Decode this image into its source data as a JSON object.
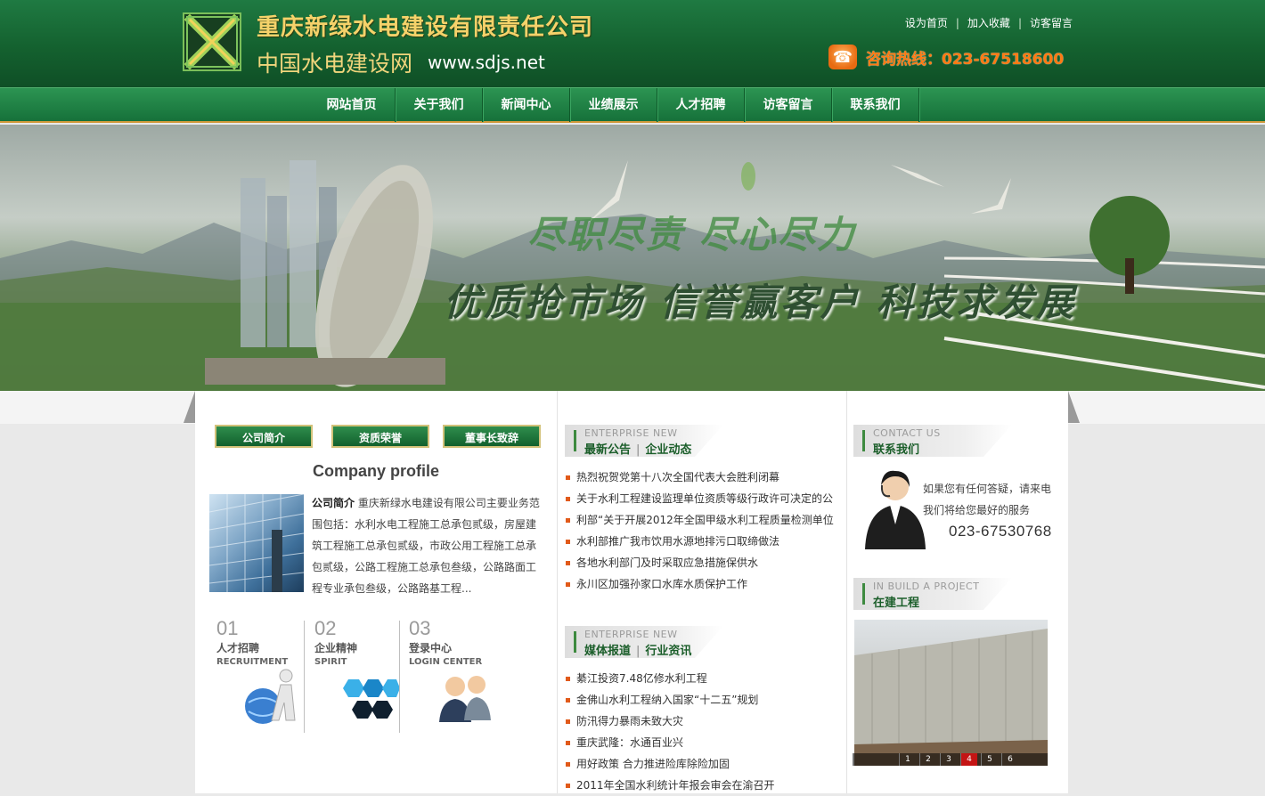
{
  "header": {
    "company_name": "重庆新绿水电建设有限责任公司",
    "site_name": "中国水电建设网",
    "site_url": "www.sdjs.net",
    "top_links": [
      "设为首页",
      "加入收藏",
      "访客留言"
    ],
    "hotline": "咨询热线：023-67518600"
  },
  "nav": {
    "items": [
      "网站首页",
      "关于我们",
      "新闻中心",
      "业绩展示",
      "人才招聘",
      "访客留言",
      "联系我们"
    ]
  },
  "banner": {
    "slogan_top": "尽职尽责 尽心尽力",
    "slogan_main": "优质抢市场 信誉赢客户 科技求发展"
  },
  "about": {
    "tabs": [
      "公司简介",
      "资质荣誉",
      "董事长致辞"
    ],
    "heading": "Company profile",
    "intro_label": "公司简介",
    "intro_text": "重庆新绿水电建设有限公司主要业务范围包括：水利水电工程施工总承包贰级，房屋建筑工程施工总承包贰级，市政公用工程施工总承包贰级，公路工程施工总承包叁级，公路路面工程专业承包叁级，公路路基工程..."
  },
  "quick_links": [
    {
      "num": "01",
      "title": "人才招聘",
      "en": "RECRUITMENT",
      "icon": "globe-person-icon"
    },
    {
      "num": "02",
      "title": "企业精神",
      "en": "SPIRIT",
      "icon": "hexagon-cluster-icon"
    },
    {
      "num": "03",
      "title": "登录中心",
      "en": "LOGIN CENTER",
      "icon": "users-icon"
    }
  ],
  "news_section": {
    "en": "ENTERPRISE NEW",
    "tab1": "最新公告",
    "tab2": "企业动态",
    "items": [
      "热烈祝贺党第十八次全国代表大会胜利闭幕",
      "关于水利工程建设监理单位资质等级行政许可决定的公",
      "利部“关于开展2012年全国甲级水利工程质量检测单位",
      "水利部推广我市饮用水源地排污口取缔做法",
      "各地水利部门及时采取应急措施保供水",
      "永川区加强孙家口水库水质保护工作"
    ]
  },
  "media_section": {
    "en": "ENTERPRISE NEW",
    "tab1": "媒体报道",
    "tab2": "行业资讯",
    "items": [
      "綦江投资7.48亿修水利工程",
      "金佛山水利工程纳入国家“十二五”规划",
      "防汛得力暴雨未致大灾",
      "重庆武隆：水通百业兴",
      "用好政策 合力推进险库除险加固",
      "2011年全国水利统计年报会审会在渝召开"
    ]
  },
  "contact": {
    "en": "CONTACT US",
    "cn": "联系我们",
    "text": "如果您有任何答疑，请来电我们将给您最好的服务",
    "phone": "023-67530768"
  },
  "project": {
    "en": "IN BUILD A PROJECT",
    "cn": "在建工程",
    "pages": [
      "1",
      "2",
      "3",
      "4",
      "5",
      "6"
    ],
    "active_page": "4"
  },
  "colors": {
    "brand_green": "#16713a",
    "accent_orange": "#ff7a12",
    "gold": "#f5d26a"
  }
}
